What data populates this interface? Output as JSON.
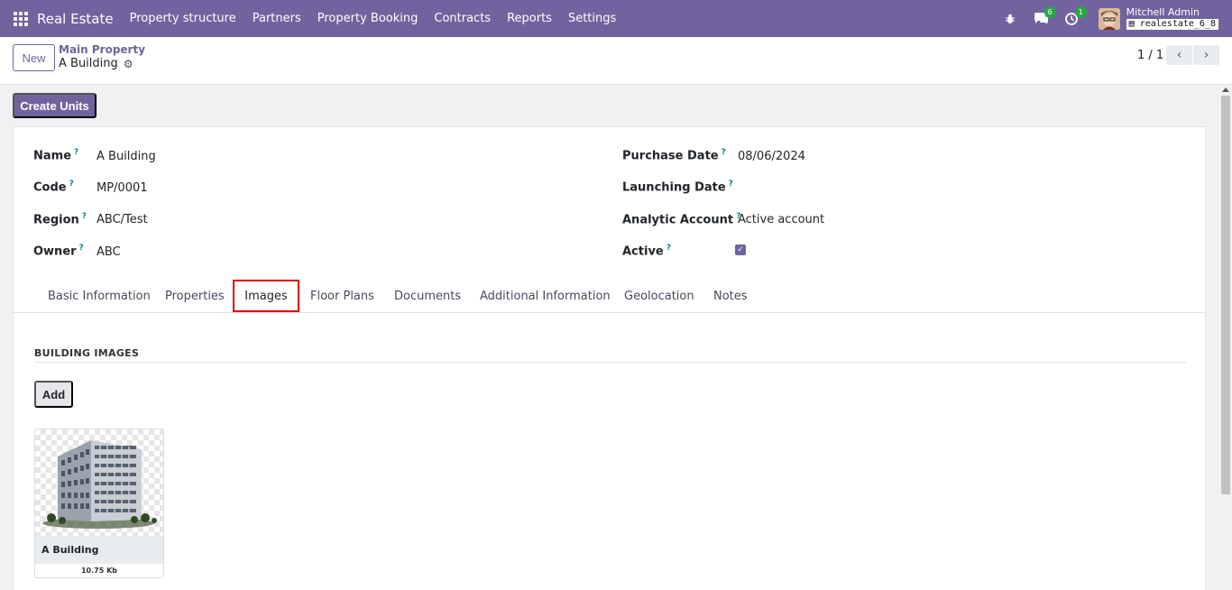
{
  "navbar": {
    "brand": "Real Estate",
    "menu": [
      "Property structure",
      "Partners",
      "Property Booking",
      "Contracts",
      "Reports",
      "Settings"
    ],
    "messages_count": "6",
    "activities_count": "1",
    "user_name": "Mitchell Admin",
    "db_name": "realestate_6_8",
    "icons": [
      "apps-grid-icon",
      "bug-icon",
      "chat-icon",
      "clock-icon"
    ]
  },
  "control_panel": {
    "new_label": "New",
    "breadcrumb": "Main Property",
    "record_title": "A Building",
    "pager": "1 / 1"
  },
  "actions": {
    "create_units": "Create Units"
  },
  "form": {
    "left": [
      {
        "label": "Name",
        "value": "A Building"
      },
      {
        "label": "Code",
        "value": "MP/0001"
      },
      {
        "label": "Region",
        "value": "ABC/Test"
      },
      {
        "label": "Owner",
        "value": "ABC"
      }
    ],
    "right": [
      {
        "label": "Purchase Date",
        "value": "08/06/2024"
      },
      {
        "label": "Launching Date",
        "value": ""
      },
      {
        "label": "Analytic Account",
        "value": "Active account"
      },
      {
        "label": "Active",
        "value": ""
      }
    ],
    "help_mark": "?",
    "active_checked": true
  },
  "tabs": [
    "Basic Information",
    "Properties",
    "Images",
    "Floor Plans",
    "Documents",
    "Additional Information",
    "Geolocation",
    "Notes"
  ],
  "active_tab": "Images",
  "images_section": {
    "title": "BUILDING IMAGES",
    "add_label": "Add",
    "cards": [
      {
        "name": "A Building",
        "size": "10.75 Kb"
      }
    ]
  },
  "colors": {
    "primary": "#71639e",
    "badge": "#28a745",
    "highlight": "#dd0000"
  }
}
